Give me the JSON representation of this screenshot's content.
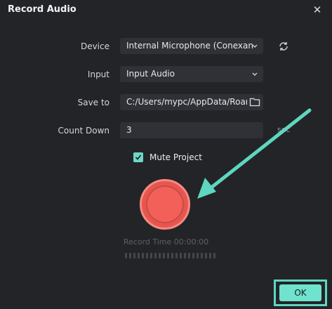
{
  "window": {
    "title": "Record Audio",
    "close_glyph": "✕"
  },
  "form": {
    "device": {
      "label": "Device",
      "value": "Internal Microphone (Conexant ISS"
    },
    "input": {
      "label": "Input",
      "value": "Input Audio"
    },
    "save_to": {
      "label": "Save to",
      "value": "C:/Users/mypc/AppData/Roan"
    },
    "count_down": {
      "label": "Count Down",
      "value": "3",
      "unit": "sec"
    },
    "mute_project": {
      "label": "Mute Project",
      "checked": true
    }
  },
  "recorder": {
    "record_time_label": "Record Time 00:00:00"
  },
  "footer": {
    "ok_label": "OK"
  },
  "colors": {
    "background": "#232428",
    "accent": "#6fe3cd",
    "record": "#f3605a",
    "annotation_arrow": "#5fd6bf"
  },
  "icons": {
    "close": "close-icon",
    "refresh": "refresh-icon",
    "chevron": "chevron-down-icon",
    "folder": "folder-icon",
    "check": "check-icon",
    "record": "record-icon",
    "arrow": "annotation-arrow-icon"
  }
}
